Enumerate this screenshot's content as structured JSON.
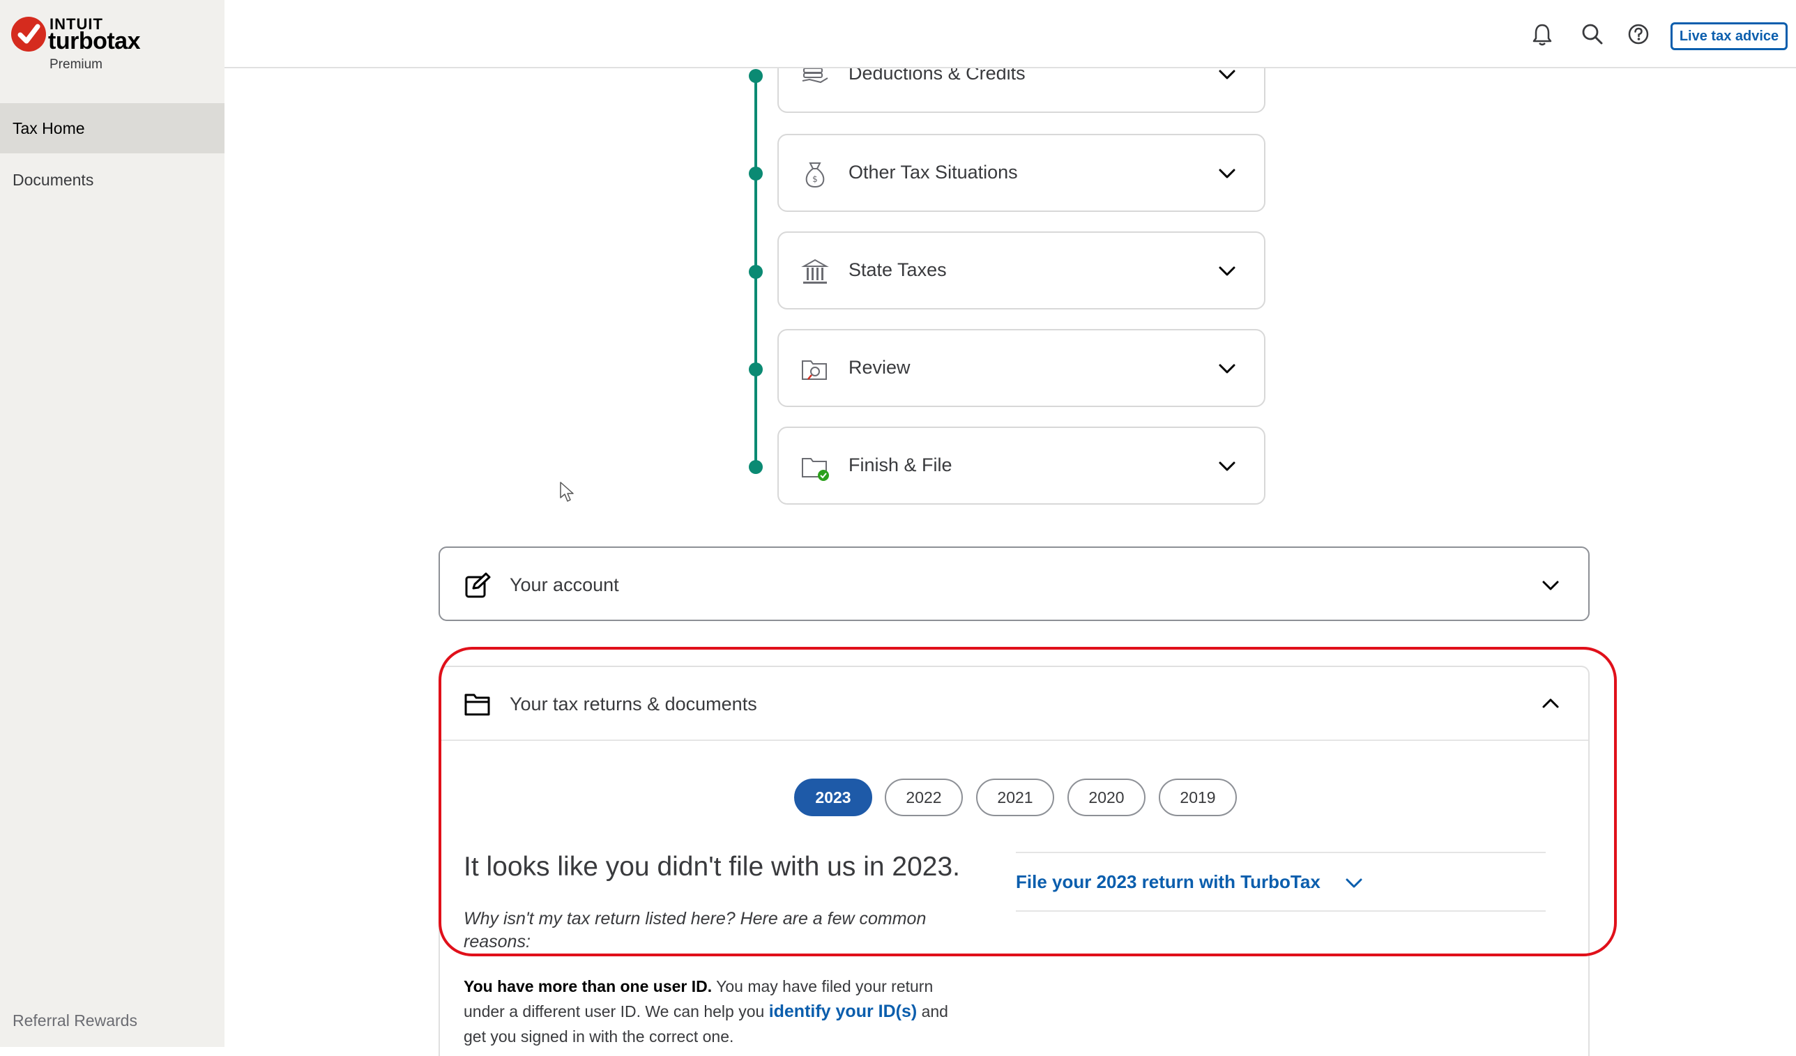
{
  "brand": {
    "intuit": "INTUIT",
    "product": "turbotax",
    "edition": "Premium",
    "accent_color": "#d52b1e"
  },
  "sidebar": {
    "items": [
      {
        "label": "Tax Home",
        "active": true
      },
      {
        "label": "Documents",
        "active": false
      }
    ],
    "referral": "Referral Rewards"
  },
  "header": {
    "icons": [
      "bell-icon",
      "search-icon",
      "help-icon"
    ],
    "live_button": "Live tax advice"
  },
  "steps": [
    {
      "label": "Deductions & Credits",
      "icon": "hand-coins-icon"
    },
    {
      "label": "Other Tax Situations",
      "icon": "money-bag-icon"
    },
    {
      "label": "State Taxes",
      "icon": "building-icon"
    },
    {
      "label": "Review",
      "icon": "review-folder-icon"
    },
    {
      "label": "Finish & File",
      "icon": "finish-folder-icon"
    }
  ],
  "account": {
    "label": "Your account"
  },
  "returns": {
    "label": "Your tax returns & documents",
    "years": [
      {
        "label": "2023",
        "active": true
      },
      {
        "label": "2022",
        "active": false
      },
      {
        "label": "2021",
        "active": false
      },
      {
        "label": "2020",
        "active": false
      },
      {
        "label": "2019",
        "active": false
      }
    ],
    "heading": "It looks like you didn't file with us in 2023.",
    "why": "Why isn't my tax return listed here? Here are a few common reasons:",
    "file_link": "File your 2023 return with TurboTax",
    "multi_id": {
      "bold": "You have more than one user ID.",
      "text1": " You may have filed your return under a different user ID. We can help you ",
      "link": "identify your ID(s)",
      "text2": " and get you signed in with the correct one."
    }
  },
  "colors": {
    "timeline": "#0b8a73",
    "link": "#0b5ead",
    "active_year": "#1e5aa8",
    "highlight": "#e0101a"
  }
}
